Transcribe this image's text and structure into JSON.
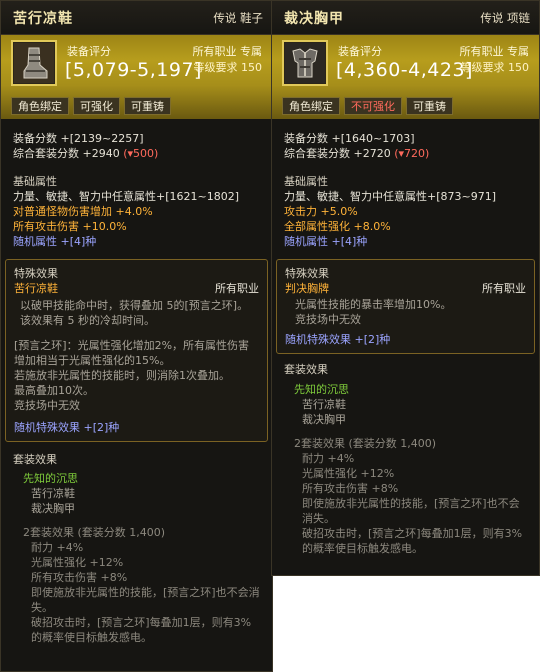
{
  "left": {
    "name": "苦行凉鞋",
    "type": "传说 鞋子",
    "score_label": "装备评分",
    "score_range": "[5,079-5,197]",
    "class": "所有职业 专属",
    "level_req": "等级要求 150",
    "buttons": [
      "角色绑定",
      "可强化",
      "可重铸"
    ],
    "equip_score": "装备分数 +[2139~2257]",
    "set_score": "综合套装分数 +2940",
    "set_score_delta": "(▾500)",
    "base_title": "基础属性",
    "base_stat": "力量、敏捷、智力中任意属性+[1621~1802]",
    "stat_a": "对普通怪物伤害增加 +4.0%",
    "stat_b": "所有攻击伤害 +10.0%",
    "random_attr": "随机属性 +[4]种",
    "special_title": "特殊效果",
    "special_name": "苦行凉鞋",
    "special_class": "所有职业",
    "special_lines": [
      "以破甲技能命中时，获得叠加 5的[预言之环]。该效果有 5 秒的冷却时间。",
      "[预言之环]：光属性强化增加2%，所有属性伤害增加相当于光属性强化的15%。",
      "若施放非光属性的技能时，则消除1次叠加。",
      "最高叠加10次。",
      "竞技场中无效"
    ],
    "special_random": "随机特殊效果 +[2]种",
    "set_title": "套装效果",
    "set_name": "先知的沉思",
    "set_items": [
      "苦行凉鞋",
      "裁决胸甲"
    ],
    "set_bonus_head": "2套装效果 (套装分数 1,400)",
    "set_bonus_lines": [
      "耐力 +4%",
      "光属性强化 +12%",
      "所有攻击伤害 +8%",
      "即使施放非光属性的技能，[预言之环]也不会消失。",
      "破招攻击时，[预言之环]每叠加1层，则有3%的概率使目标触发感电。"
    ]
  },
  "right": {
    "name": "裁决胸甲",
    "type": "传说 项链",
    "score_label": "装备评分",
    "score_range": "[4,360-4,423]",
    "class": "所有职业 专属",
    "level_req": "等级要求 150",
    "buttons": [
      "角色绑定",
      "不可强化",
      "可重铸"
    ],
    "equip_score": "装备分数 +[1640~1703]",
    "set_score": "综合套装分数 +2720",
    "set_score_delta": "(▾720)",
    "base_title": "基础属性",
    "base_stat": "力量、敏捷、智力中任意属性+[873~971]",
    "stat_a": "攻击力 +5.0%",
    "stat_b": "全部属性强化 +8.0%",
    "random_attr": "随机属性 +[4]种",
    "special_title": "特殊效果",
    "special_name": "判决胸牌",
    "special_class": "所有职业",
    "special_lines": [
      "光属性技能的暴击率增加10%。",
      "竞技场中无效"
    ],
    "special_random": "随机特殊效果 +[2]种",
    "set_title": "套装效果",
    "set_name": "先知的沉思",
    "set_items": [
      "苦行凉鞋",
      "裁决胸甲"
    ],
    "set_bonus_head": "2套装效果 (套装分数 1,400)",
    "set_bonus_lines": [
      "耐力 +4%",
      "光属性强化 +12%",
      "所有攻击伤害 +8%",
      "即使施放非光属性的技能，[预言之环]也不会消失。",
      "破招攻击时，[预言之环]每叠加1层，则有3%的概率使目标触发感电。"
    ]
  },
  "colors": {
    "panel_bg": "#161512",
    "gold_band": "#b79d1d",
    "set_name_green": "#7ecb3b",
    "random_blue": "#9ba4ff",
    "special_orange": "#ffb339",
    "delta_red": "#ff6a5c"
  },
  "icons": {
    "left_item": "boot-icon",
    "right_item": "chest-armor-icon"
  }
}
